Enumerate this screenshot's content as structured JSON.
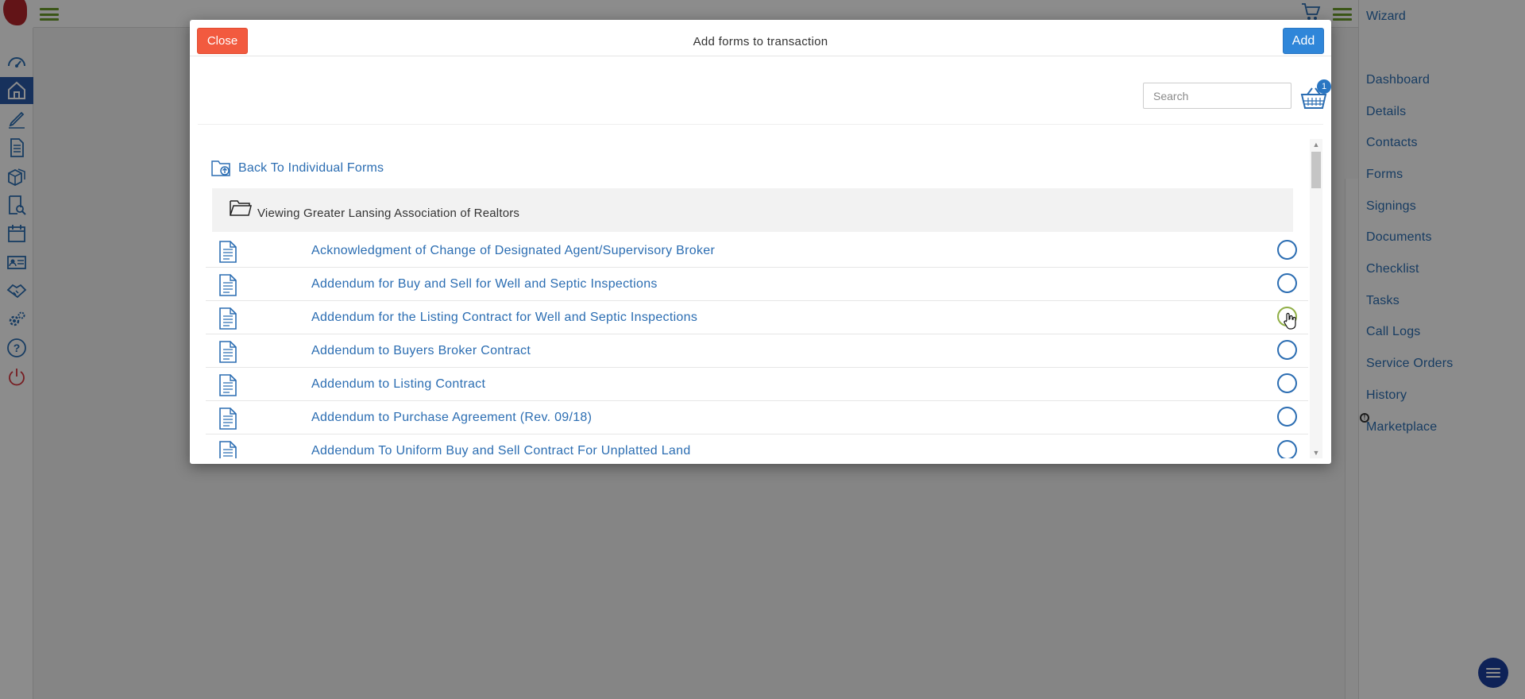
{
  "app": {
    "right_panel": {
      "wizard_label": "Wizard",
      "links": [
        "Dashboard",
        "Details",
        "Contacts",
        "Forms",
        "Signings",
        "Documents",
        "Checklist",
        "Tasks",
        "Call Logs",
        "Service Orders",
        "History",
        "Marketplace"
      ]
    },
    "left_nav_icons": [
      "dashboard-gauge-icon",
      "home-icon",
      "pen-icon",
      "document-icon",
      "boxes-icon",
      "search-document-icon",
      "calendar-icon",
      "contact-card-icon",
      "handshake-icon",
      "settings-gears-icon",
      "help-icon",
      "power-icon"
    ],
    "active_nav": "home-icon"
  },
  "modal": {
    "title": "Add forms to transaction",
    "close_label": "Close",
    "add_label": "Add",
    "search_placeholder": "Search",
    "basket_count": "1",
    "back_label": "Back To Individual Forms",
    "viewing_label": "Viewing Greater Lansing Association of Realtors",
    "forms": [
      {
        "name": "Acknowledgment of Change of Designated Agent/Supervisory Broker",
        "selected": false
      },
      {
        "name": "Addendum for Buy and Sell for Well and Septic Inspections",
        "selected": false
      },
      {
        "name": "Addendum for the Listing Contract for Well and Septic Inspections",
        "selected": false
      },
      {
        "name": "Addendum to Buyers Broker Contract",
        "selected": false
      },
      {
        "name": "Addendum to Listing Contract",
        "selected": false
      },
      {
        "name": "Addendum to Purchase Agreement (Rev. 09/18)",
        "selected": false
      },
      {
        "name": "Addendum To Uniform Buy and Sell Contract For Unplatted Land",
        "selected": false
      }
    ]
  },
  "colors": {
    "accent_blue": "#2b6db2",
    "close_red": "#f25a3f",
    "add_blue": "#2f86d9",
    "nav_active": "#2a5aa8",
    "hamburger_green": "#6a9b2a"
  }
}
